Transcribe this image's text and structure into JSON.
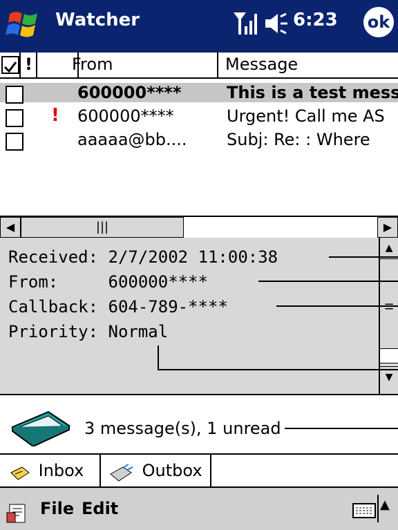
{
  "titlebar": {
    "app_title": "Watcher",
    "clock": "6:23",
    "ok_label": "ok"
  },
  "list": {
    "columns": {
      "from": "From",
      "message": "Message"
    },
    "rows": [
      {
        "from": "600000****",
        "message": "This is a test mess",
        "priority": "",
        "selected": true
      },
      {
        "from": "600000****",
        "message": "Urgent! Call me AS",
        "priority": "!",
        "selected": false
      },
      {
        "from": "aaaaa@bb....",
        "message": " Subj: Re:  : Where",
        "priority": "",
        "selected": false
      }
    ]
  },
  "hscroll": {
    "thumb": "|||"
  },
  "details": {
    "line1": "Received: 2/7/2002 11:00:38",
    "line2": "From:     600000****",
    "line3": "Callback: 604-789-****",
    "line4": "Priority: Normal"
  },
  "status": {
    "text": "3 message(s), 1 unread"
  },
  "tabs": {
    "inbox": "Inbox",
    "outbox": "Outbox"
  },
  "menu": {
    "file": "File",
    "edit": "Edit"
  },
  "colors": {
    "titlebar": "#0a2470",
    "pane": "#d8d8d8",
    "priority": "#e00000",
    "selection": "#c6c6c6"
  }
}
